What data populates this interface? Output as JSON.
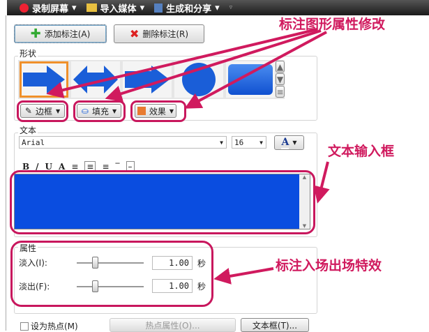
{
  "toolbar": {
    "record": "录制屏幕",
    "import": "导入媒体",
    "produce": "生成和分享"
  },
  "buttons": {
    "add": "添加标注(A)",
    "delete": "删除标注(R)"
  },
  "shape": {
    "label": "形状",
    "border": "边框",
    "fill": "填充",
    "effect": "效果"
  },
  "text": {
    "label": "文本",
    "font": "Arial",
    "size": "16"
  },
  "props": {
    "label": "属性",
    "fade_in": "淡入(I):",
    "fade_out": "淡出(F):",
    "fade_in_value": "1.00",
    "fade_out_value": "1.00",
    "unit": "秒",
    "fade_in_slider": 0.25,
    "fade_out_slider": 0.25
  },
  "bottom": {
    "hotspot": "设为热点(M)",
    "hotspot_props": "热点属性(O)...",
    "textbox": "文本框(T)..."
  },
  "annotations": {
    "shape_props": "标注图形属性修改",
    "text_input": "文本输入框",
    "fade_effects": "标注入场出场特效"
  },
  "colors": {
    "accent": "#c8175d",
    "textarea": "#0a4de0"
  }
}
